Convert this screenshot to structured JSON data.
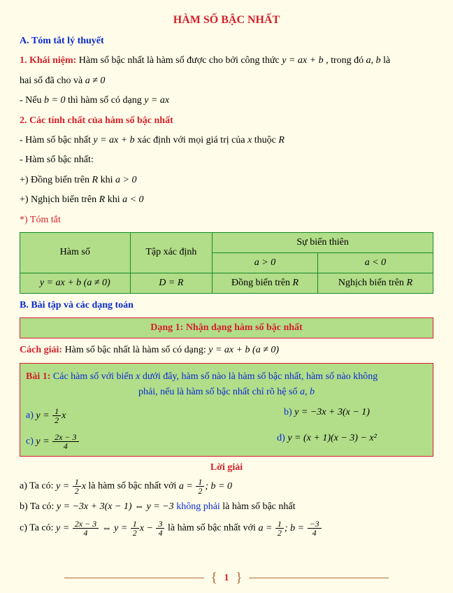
{
  "title": "HÀM SỐ BẬC NHẤT",
  "secA": "A. Tóm tắt lý thuyết",
  "kn_label": "1. Khái niệm:",
  "kn_text1": "Hàm số bậc nhất là hàm số được cho bởi công thức ",
  "kn_eq": "y = ax + b",
  "kn_text2": ", trong đó ",
  "kn_ab": "a, b",
  "kn_text3": " là",
  "kn_line2a": "hai số đã cho và ",
  "kn_line2b": "a ≠ 0",
  "kn_note1a": "- Nếu ",
  "kn_note1b": "b = 0",
  "kn_note1c": " thì hàm số có dạng ",
  "kn_note1d": "y = ax",
  "sec2": "2. Các tính chất của hàm số bậc nhất",
  "tc1a": "- Hàm số bậc nhất ",
  "tc1b": "y = ax + b",
  "tc1c": " xác định với mọi giá trị của ",
  "tc1d": "x",
  "tc1e": " thuộc ",
  "tc1f": "R",
  "tc2": "- Hàm số bậc nhất:",
  "tc3a": "+) Đồng biến trên ",
  "tc3r": "R",
  "tc3b": " khi ",
  "tc3c": "a > 0",
  "tc4a": "+) Nghịch biến trên ",
  "tc4b": " khi ",
  "tc4c": "a < 0",
  "tomtat": "*) Tóm tắt",
  "th_hamso": "Hàm số",
  "th_txd": "Tập xác định",
  "th_sbt": "Sự biến thiên",
  "th_agt": "a > 0",
  "th_alt": "a < 0",
  "td_eq": "y = ax + b (a ≠ 0)",
  "td_DR": "D = R",
  "td_dong": "Đồng biến trên ",
  "td_r1": "R",
  "td_nghich": "Nghịch biến trên ",
  "td_r2": "R",
  "secB": "B. Bài tập và các dạng toán",
  "dang1": "Dạng 1: Nhận dạng hàm số bậc nhất",
  "cg_label": "Cách giải:",
  "cg_text": "  Hàm số bậc nhất là hàm số có dạng: ",
  "cg_eq": "y = ax + b (a ≠ 0)",
  "bai1_label": "Bài 1:",
  "bai1_t1": " Các hàm số với biến ",
  "bai1_x": "x",
  "bai1_t2": " dưới đây, hàm số nào là hàm số bậc nhất, hàm số nào không",
  "bai1_line2a": "phải, nếu là hàm số bậc nhất chỉ rõ hệ số ",
  "bai1_line2b": "a, b",
  "opt_a_lab": "a)",
  "opt_a_pre": "y = ",
  "opt_a_num": "1",
  "opt_a_den": "2",
  "opt_a_suf": "x",
  "opt_b_lab": "b)",
  "opt_b_eq": "y = −3x + 3(x − 1)",
  "opt_c_lab": "c)",
  "opt_c_pre": "y = ",
  "opt_c_num": "2x − 3",
  "opt_c_den": "4",
  "opt_d_lab": "d)",
  "opt_d_eq": "y = (x + 1)(x − 3) − x²",
  "loigiai": "Lời giải",
  "sa_pre": "a) Ta có: ",
  "sa_y": "y = ",
  "sa_n1": "1",
  "sa_d1": "2",
  "sa_xpost": "x",
  "sa_mid": " là hàm số bậc nhất với ",
  "sa_a": "a = ",
  "sa_n2": "1",
  "sa_d2": "2",
  "sa_semib": "; b = 0",
  "sb_pre": "b) Ta có: ",
  "sb_eq": "y = −3x + 3(x − 1) ⇔ y = −3 ",
  "sb_kp": "không phải",
  "sb_post": " là hàm số bậc nhất",
  "sc_pre": "c) Ta có: ",
  "sc_y": "y = ",
  "sc_n1": "2x − 3",
  "sc_d1": "4",
  "sc_iff": " ⇔ y = ",
  "sc_n2": "1",
  "sc_d2": "2",
  "sc_mid1": "x − ",
  "sc_n3": "3",
  "sc_d3": "4",
  "sc_mid2": " là hàm số bậc nhất với ",
  "sc_a": "a = ",
  "sc_n4": "1",
  "sc_d4": "2",
  "sc_b": "; b = ",
  "sc_n5": "−3",
  "sc_d5": "4",
  "pagenum": "1"
}
